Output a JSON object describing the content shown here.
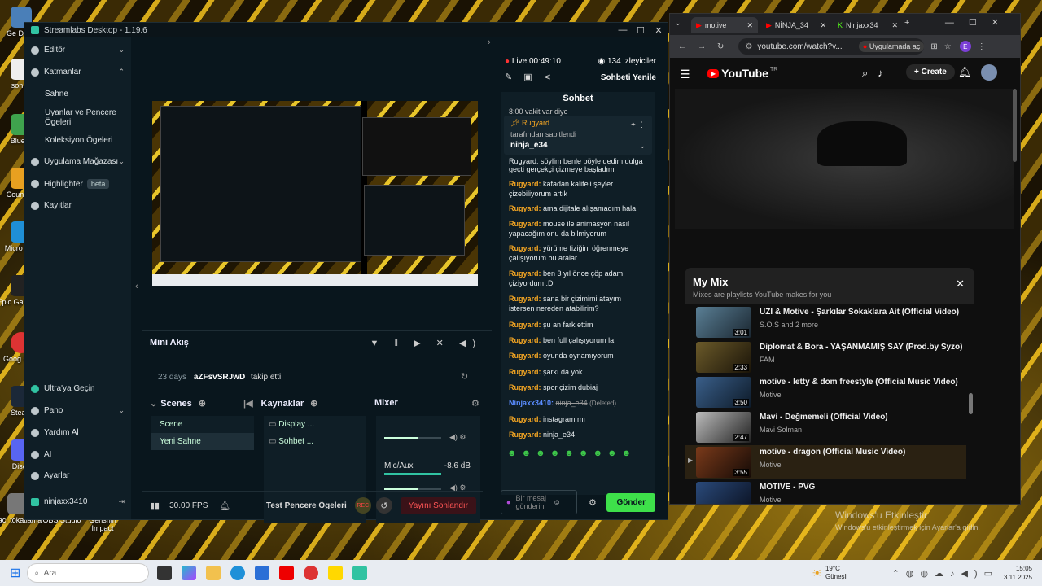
{
  "desktop": {
    "icons": [
      "Ge Dönü",
      "son m",
      "BlueSt",
      "Counte 2",
      "Micro Edg",
      "Epic Ga Launc",
      "Goog Chro",
      "Steam",
      "Disco",
      "bacı tokatlama",
      "OBS Studio",
      "Genshin Impact"
    ]
  },
  "streamlabs": {
    "title": "Streamlabs Desktop - 1.19.6",
    "sidebar": {
      "editor": "Editör",
      "themes": "Katmanlar",
      "sub_items": [
        "Sahne",
        "Uyanlar ve Pencere Ögeleri",
        "Koleksiyon Ögeleri"
      ],
      "app_store": "Uygulama Mağazası",
      "highlighter": "Highlighter",
      "beta": "beta",
      "recordings": "Kayıtlar",
      "ultra": "Ultra'ya Geçin",
      "dashboard": "Pano",
      "help": "Yardım Al",
      "ai": "AI",
      "settings": "Ayarlar",
      "user": "ninjaxx3410"
    },
    "mini_feed": {
      "title": "Mini Akış",
      "event_age": "23 days",
      "event_user": "aZFsvSRJwD",
      "event_text": "takip etti"
    },
    "scenes": {
      "title": "Scenes",
      "items": [
        "Scene",
        "Yeni Sahne"
      ]
    },
    "sources": {
      "title": "Kaynaklar",
      "items": [
        "Display ...",
        "Sohbet ..."
      ]
    },
    "mixer": {
      "title": "Mixer",
      "mic_label": "Mic/Aux",
      "mic_db": "-8.6 dB",
      "mic_level": 0.6,
      "desktop_level": 0.6
    },
    "status": {
      "fps": "30.00 FPS",
      "test_widgets": "Test Pencere Ögeleri",
      "rec": "REC",
      "end_stream": "Yayını Sonlandır"
    },
    "live": {
      "live_label": "Live",
      "time": "00:49:10",
      "viewers": "134 izleyiciler",
      "refresh_chat": "Sohbeti Yenile"
    },
    "chat": {
      "title": "Sohbet",
      "top_partial": "8:00 vakit var diye",
      "pinned_user": "Rugyard",
      "pinned_by": "tarafından sabitlendi",
      "pinned_text": "ninja_e34",
      "partial_line": "Rugyard: söylim benle böyle dedim dulga",
      "messages": [
        {
          "user": "",
          "text": "geçti gerçekçi çizmeye başladım"
        },
        {
          "user": "Rugyard:",
          "text": "kafadan kaliteli şeyler çizebiliyorum artık"
        },
        {
          "user": "Rugyard:",
          "text": "ama dijitale alışamadım hala"
        },
        {
          "user": "Rugyard:",
          "text": "mouse ile animasyon nasıl yapacağım onu da bilmiyorum"
        },
        {
          "user": "Rugyard:",
          "text": "yürüme fiziğini öğrenmeye çalışıyorum bu aralar"
        },
        {
          "user": "Rugyard:",
          "text": "ben 3 yıl önce çöp adam çiziyordum :D"
        },
        {
          "user": "Rugyard:",
          "text": "sana bir çizimimi atayım istersen nereden atabilirim?"
        },
        {
          "user": "Rugyard:",
          "text": "şu an fark ettim"
        },
        {
          "user": "Rugyard:",
          "text": "ben full çalışıyorum la"
        },
        {
          "user": "Rugyard:",
          "text": "oyunda oynamıyorum"
        },
        {
          "user": "Rugyard:",
          "text": "şarkı da yok"
        },
        {
          "user": "Rugyard:",
          "text": "spor çizim dubiaj"
        },
        {
          "user": "Ninjaxx3410:",
          "text": "ninja_e34",
          "deleted": "(Deleted)"
        },
        {
          "user": "Rugyard:",
          "text": "instagram mı"
        },
        {
          "user": "Rugyard:",
          "text": "ninja_e34"
        }
      ],
      "placeholder": "Bir mesaj gönderin",
      "send": "Gönder"
    }
  },
  "browser": {
    "tabs": [
      "motive",
      "NİNJA_34",
      "Ninjaxx34"
    ],
    "url": "youtube.com/watch?v...",
    "open_in_app": "Uygulamada aç",
    "profile_letter": "E",
    "youtube": {
      "logo": "YouTube",
      "region": "TR",
      "create": "Create",
      "mix_title": "My Mix",
      "mix_subtitle": "Mixes are playlists YouTube makes for you",
      "items": [
        {
          "title": "UZI & Motive - Şarkılar Sokaklara Ait (Official Video)",
          "artist": "S.O.S and 2 more",
          "duration": "3:01"
        },
        {
          "title": "Diplomat & Bora - YAŞANMAMIŞ SAY (Prod.by Syzo)",
          "artist": "FAM",
          "duration": "2:33"
        },
        {
          "title": "motive - letty & dom freestyle (Official Music Video)",
          "artist": "Motive",
          "duration": "3:50"
        },
        {
          "title": "Mavi - Değmemeli (Official Video)",
          "artist": "Mavi Solman",
          "duration": "2:47"
        },
        {
          "title": "motive - dragon (Official Music Video)",
          "artist": "Motive",
          "duration": "3:55",
          "playing": true
        },
        {
          "title": "MOTIVE - PVG",
          "artist": "Motive",
          "duration": ""
        }
      ]
    }
  },
  "watermark": {
    "line1": "Windows'u Etkinleştir",
    "line2": "Windows'u etkinleştirmek için Ayarlar'a gidin."
  },
  "taskbar": {
    "search": "Ara",
    "weather_temp": "19°C",
    "weather_desc": "Güneşli",
    "time": "15:05",
    "date": "3.11.2025"
  },
  "colors": {
    "streamlabs_bg": "#09161d",
    "streamlabs_accent": "#31c3a2",
    "chat_user": "#f5a623",
    "youtube_red": "#ff0000"
  }
}
